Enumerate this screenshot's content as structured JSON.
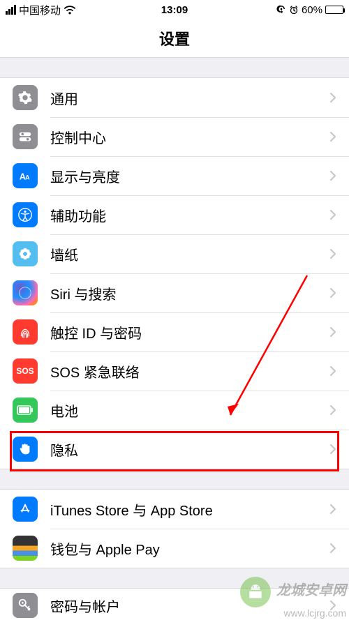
{
  "status": {
    "carrier": "中国移动",
    "time": "13:09",
    "battery_pct": "60%"
  },
  "header": {
    "title": "设置"
  },
  "groups": [
    {
      "rows": [
        {
          "key": "general",
          "label": "通用"
        },
        {
          "key": "control",
          "label": "控制中心"
        },
        {
          "key": "display",
          "label": "显示与亮度"
        },
        {
          "key": "accessibility",
          "label": "辅助功能"
        },
        {
          "key": "wallpaper",
          "label": "墙纸"
        },
        {
          "key": "siri",
          "label": "Siri 与搜索"
        },
        {
          "key": "touchid",
          "label": "触控 ID 与密码"
        },
        {
          "key": "sos",
          "label": "SOS 紧急联络"
        },
        {
          "key": "battery",
          "label": "电池"
        },
        {
          "key": "privacy",
          "label": "隐私"
        }
      ]
    },
    {
      "rows": [
        {
          "key": "itunes",
          "label": "iTunes Store 与 App Store"
        },
        {
          "key": "wallet",
          "label": "钱包与 Apple Pay"
        }
      ]
    },
    {
      "rows": [
        {
          "key": "passwords",
          "label": "密码与帐户"
        }
      ]
    }
  ],
  "annotation": {
    "highlight_row": "privacy"
  },
  "watermark": {
    "line1": "龙城安卓网",
    "line2": "www.lcjrg.com"
  },
  "sos_text": "SOS"
}
